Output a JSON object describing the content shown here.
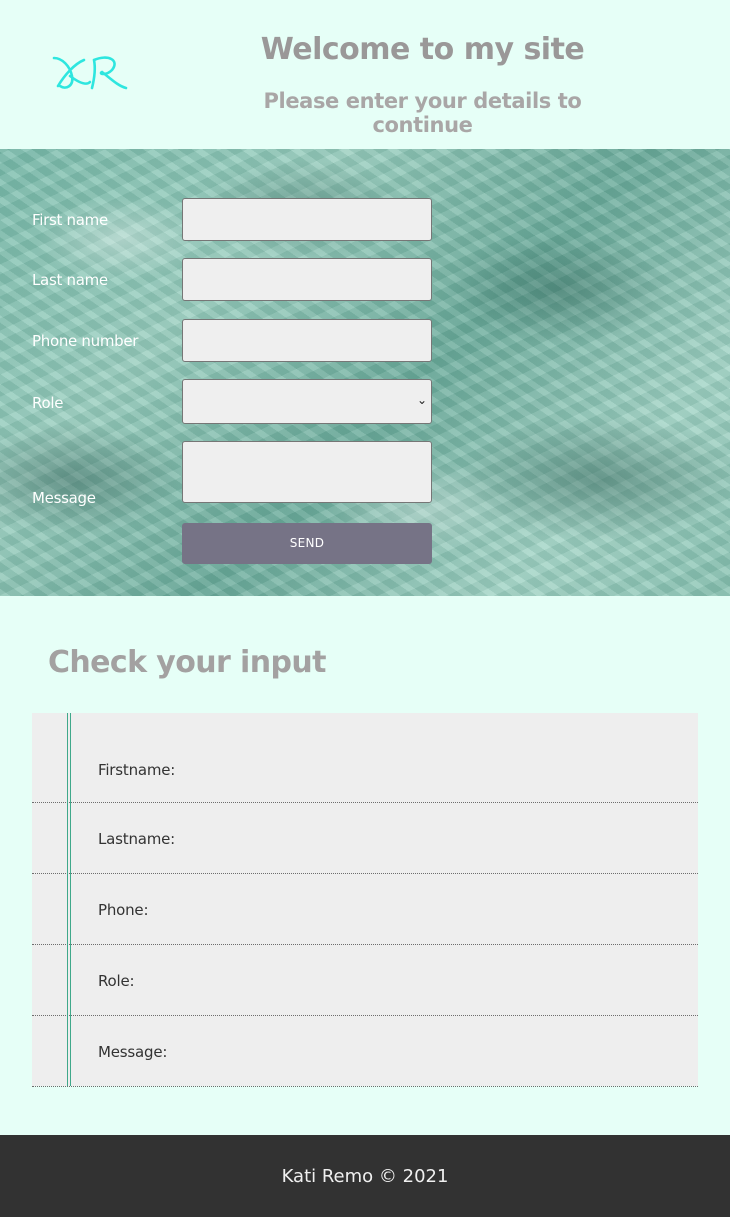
{
  "header": {
    "logo_text": "KR",
    "title": "Welcome to my site",
    "subtitle": "Please enter your details to continue"
  },
  "form": {
    "first_name_label": "First name",
    "last_name_label": "Last name",
    "phone_label": "Phone number",
    "role_label": "Role",
    "message_label": "Message",
    "first_name_value": "",
    "last_name_value": "",
    "phone_value": "",
    "role_value": "",
    "message_value": "",
    "send_label": "SEND"
  },
  "check": {
    "title": "Check your input",
    "rows": [
      {
        "label": "Firstname:"
      },
      {
        "label": "Lastname:"
      },
      {
        "label": "Phone:"
      },
      {
        "label": "Role:"
      },
      {
        "label": "Message:"
      }
    ]
  },
  "footer": {
    "text": "Kati Remo © 2021"
  },
  "colors": {
    "page_bg": "#e6fff7",
    "logo": "#2ee6df",
    "send_button": "#767386",
    "footer_bg": "#323232",
    "table_line": "#3fa88a"
  }
}
